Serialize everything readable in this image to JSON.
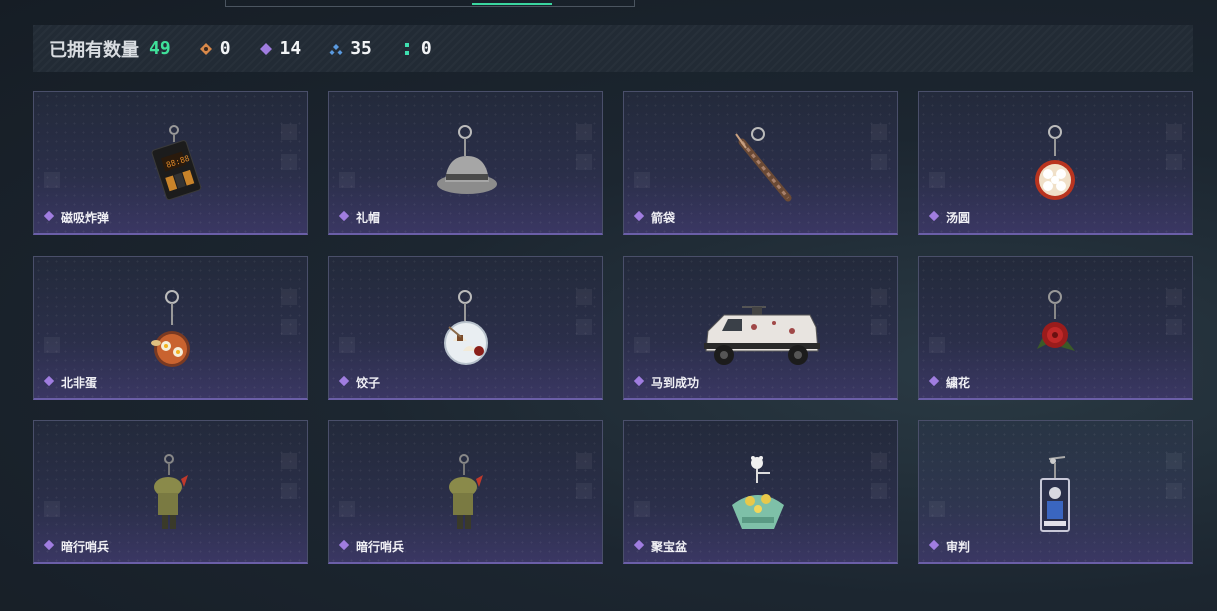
{
  "summary": {
    "owned_label": "已拥有数量",
    "owned_total": "49",
    "stats": [
      {
        "icon": "orange-diamond-icon",
        "color": "#d9894a",
        "value": "0"
      },
      {
        "icon": "purple-diamond-icon",
        "color": "#a07de0",
        "value": "14"
      },
      {
        "icon": "blue-diamond-icon",
        "color": "#5a9ae0",
        "value": "35"
      },
      {
        "icon": "green-dots-icon",
        "color": "#3fe0b0",
        "value": "0"
      }
    ]
  },
  "colors": {
    "accent": "#3fe09a",
    "rarity_purple": "#a07de0"
  },
  "items": [
    {
      "name": "磁吸炸弹",
      "icon": "magnetic-bomb-icon"
    },
    {
      "name": "礼帽",
      "icon": "fedora-hat-icon"
    },
    {
      "name": "箭袋",
      "icon": "quiver-icon"
    },
    {
      "name": "汤圆",
      "icon": "tangyuan-bowl-icon"
    },
    {
      "name": "北非蛋",
      "icon": "shakshuka-pan-icon"
    },
    {
      "name": "饺子",
      "icon": "dumpling-plate-icon"
    },
    {
      "name": "马到成功",
      "icon": "armored-vehicle-icon"
    },
    {
      "name": "繍花",
      "icon": "embroidered-rose-icon"
    },
    {
      "name": "暗行哨兵",
      "icon": "sentinel-figure-icon"
    },
    {
      "name": "暗行哨兵",
      "icon": "sentinel-figure-icon"
    },
    {
      "name": "聚宝盆",
      "icon": "treasure-bowl-icon"
    },
    {
      "name": "审判",
      "icon": "judgement-card-icon"
    }
  ]
}
